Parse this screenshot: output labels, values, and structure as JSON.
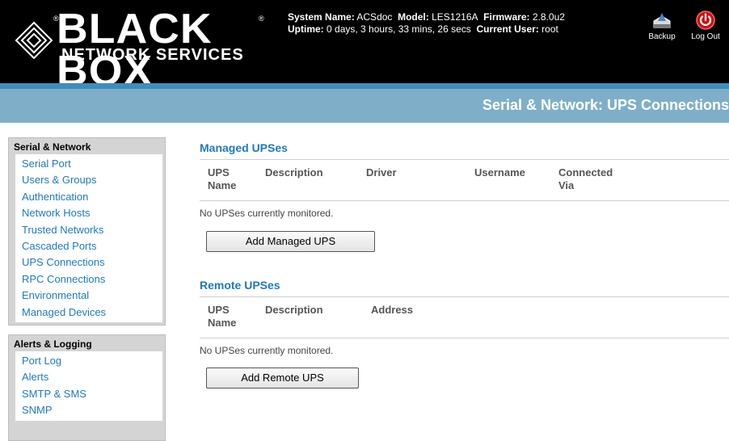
{
  "header": {
    "logo_main": "BLACK BOX",
    "logo_sub": "NETWORK SERVICES",
    "logo_reg": "®",
    "system_name_label": "System Name:",
    "system_name": "ACSdoc",
    "model_label": "Model:",
    "model": "LES1216A",
    "firmware_label": "Firmware:",
    "firmware": "2.8.0u2",
    "uptime_label": "Uptime:",
    "uptime": "0 days, 3 hours, 33 mins, 26 secs",
    "current_user_label": "Current User:",
    "current_user": "root",
    "backup_label": "Backup",
    "logout_label": "Log Out"
  },
  "page_title": "Serial & Network: UPS Connections",
  "sidebar": {
    "serial_network": {
      "heading": "Serial & Network",
      "items": [
        "Serial Port",
        "Users & Groups",
        "Authentication",
        "Network Hosts",
        "Trusted Networks",
        "Cascaded Ports",
        "UPS Connections",
        "RPC Connections",
        "Environmental",
        "Managed Devices"
      ]
    },
    "alerts_logging": {
      "heading": "Alerts & Logging",
      "items": [
        "Port Log",
        "Alerts",
        "SMTP & SMS",
        "SNMP"
      ]
    }
  },
  "managed": {
    "title": "Managed UPSes",
    "columns": [
      "UPS Name",
      "Description",
      "Driver",
      "Username",
      "Connected Via"
    ],
    "col_lines": [
      [
        "UPS",
        "Name"
      ],
      [
        "Description"
      ],
      [
        "Driver"
      ],
      [
        "Username"
      ],
      [
        "Connected",
        "Via"
      ]
    ],
    "empty_text": "No UPSes currently monitored.",
    "add_button": "Add Managed UPS"
  },
  "remote": {
    "title": "Remote UPSes",
    "columns": [
      "UPS Name",
      "Description",
      "Address"
    ],
    "col_lines": [
      [
        "UPS",
        "Name"
      ],
      [
        "Description"
      ],
      [
        "Address"
      ]
    ],
    "empty_text": "No UPSes currently monitored.",
    "add_button": "Add Remote UPS"
  },
  "colors": {
    "header_bg": "#000000",
    "title_bar": "#7fafc8",
    "title_stripe": "#3f8bbf",
    "link": "#1f78c4",
    "logout_red": "#cc1111"
  }
}
